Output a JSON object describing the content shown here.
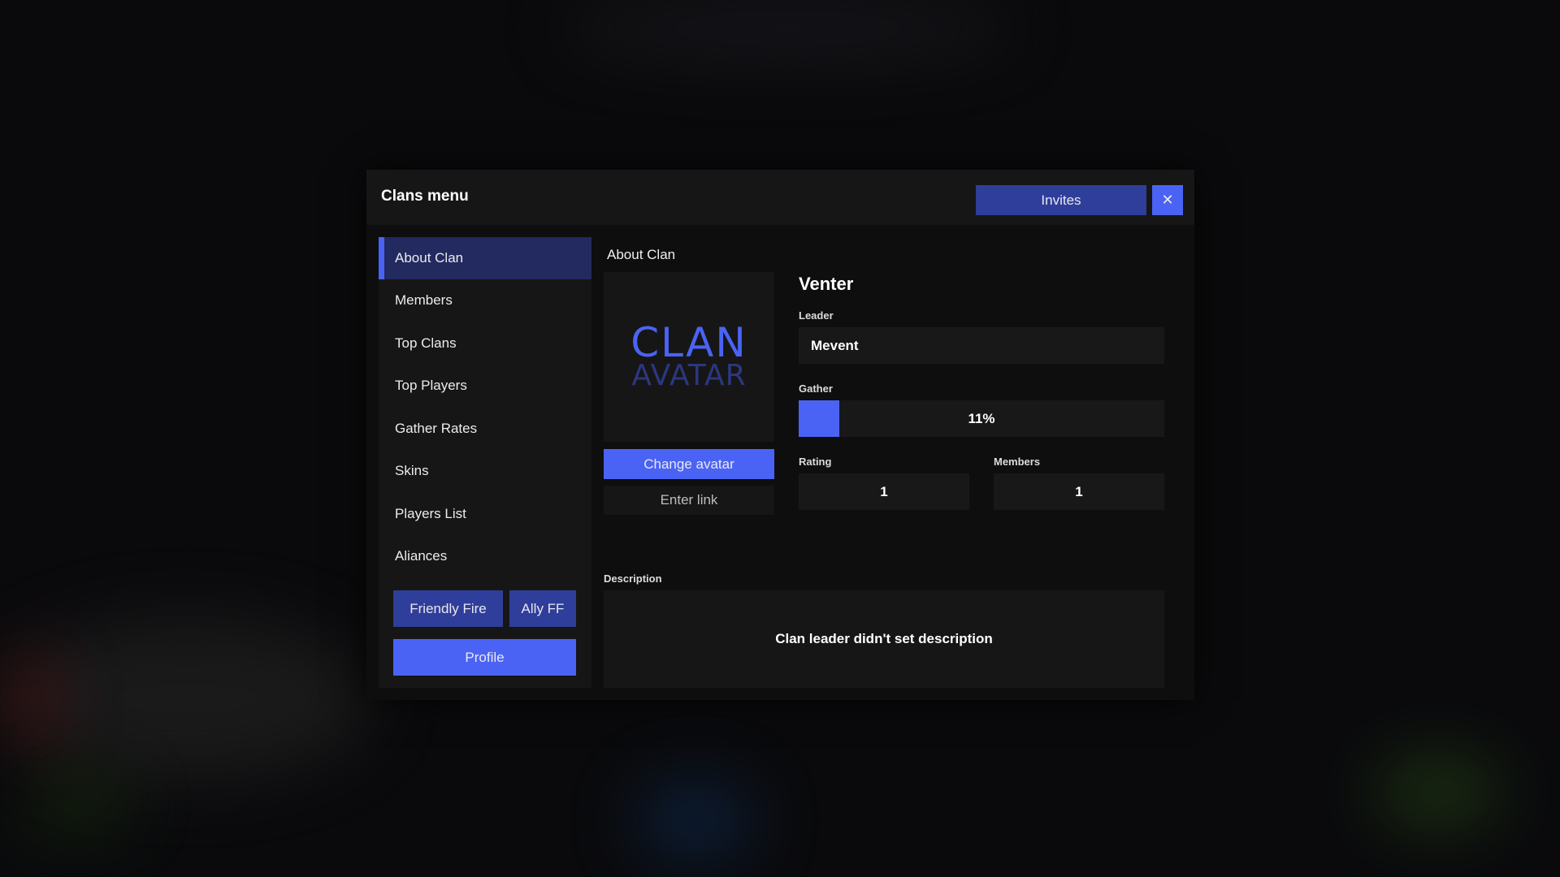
{
  "window": {
    "title": "Clans menu",
    "invites_label": "Invites",
    "close_label": "✕"
  },
  "sidebar": {
    "items": [
      {
        "label": "About Clan",
        "active": true
      },
      {
        "label": "Members",
        "active": false
      },
      {
        "label": "Top Clans",
        "active": false
      },
      {
        "label": "Top Players",
        "active": false
      },
      {
        "label": "Gather Rates",
        "active": false
      },
      {
        "label": "Skins",
        "active": false
      },
      {
        "label": "Players List",
        "active": false
      },
      {
        "label": "Aliances",
        "active": false
      }
    ],
    "friendly_fire_label": "Friendly Fire",
    "ally_ff_label": "Ally FF",
    "profile_label": "Profile"
  },
  "about": {
    "section_title": "About Clan",
    "avatar_line1": "CLAN",
    "avatar_line2": "AVATAR",
    "change_avatar_label": "Change avatar",
    "enter_link_placeholder": "Enter link",
    "clan_name": "Venter",
    "leader_label": "Leader",
    "leader_value": "Mevent",
    "gather_label": "Gather",
    "gather_percent": 11,
    "gather_text": "11%",
    "rating_label": "Rating",
    "rating_value": "1",
    "members_label": "Members",
    "members_value": "1",
    "description_label": "Description",
    "description_text": "Clan leader didn't set description"
  },
  "colors": {
    "accent": "#4a63f5",
    "accent_dark": "#2f3e9a",
    "active_bg": "#222a60"
  }
}
